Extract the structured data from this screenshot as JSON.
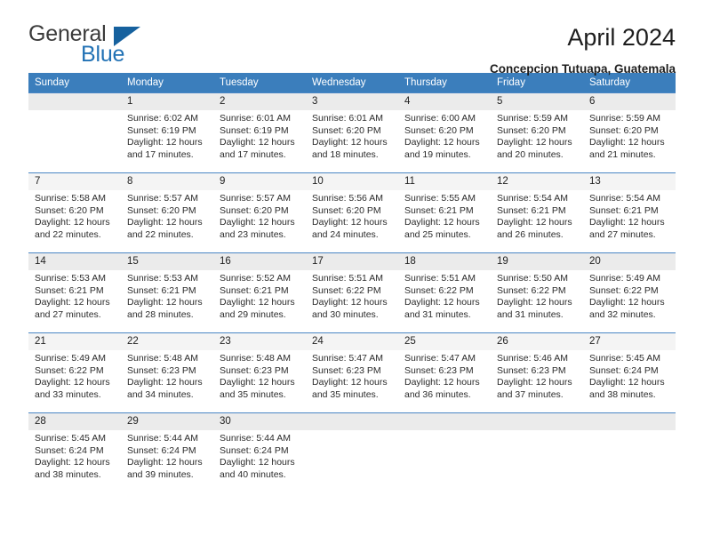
{
  "brand": {
    "name_part1": "General",
    "name_part2": "Blue",
    "triangle_color": "#16619e",
    "blue_color": "#2272b5"
  },
  "header": {
    "title": "April 2024",
    "subtitle": "Concepcion Tutuapa, Guatemala",
    "header_bg": "#3b7ebc"
  },
  "weekdays": [
    "Sunday",
    "Monday",
    "Tuesday",
    "Wednesday",
    "Thursday",
    "Friday",
    "Saturday"
  ],
  "weeks": [
    {
      "days": [
        {
          "num": "",
          "sunrise": "",
          "sunset": "",
          "daylight1": "",
          "daylight2": "",
          "empty": true
        },
        {
          "num": "1",
          "sunrise": "Sunrise: 6:02 AM",
          "sunset": "Sunset: 6:19 PM",
          "daylight1": "Daylight: 12 hours",
          "daylight2": "and 17 minutes."
        },
        {
          "num": "2",
          "sunrise": "Sunrise: 6:01 AM",
          "sunset": "Sunset: 6:19 PM",
          "daylight1": "Daylight: 12 hours",
          "daylight2": "and 17 minutes."
        },
        {
          "num": "3",
          "sunrise": "Sunrise: 6:01 AM",
          "sunset": "Sunset: 6:20 PM",
          "daylight1": "Daylight: 12 hours",
          "daylight2": "and 18 minutes."
        },
        {
          "num": "4",
          "sunrise": "Sunrise: 6:00 AM",
          "sunset": "Sunset: 6:20 PM",
          "daylight1": "Daylight: 12 hours",
          "daylight2": "and 19 minutes."
        },
        {
          "num": "5",
          "sunrise": "Sunrise: 5:59 AM",
          "sunset": "Sunset: 6:20 PM",
          "daylight1": "Daylight: 12 hours",
          "daylight2": "and 20 minutes."
        },
        {
          "num": "6",
          "sunrise": "Sunrise: 5:59 AM",
          "sunset": "Sunset: 6:20 PM",
          "daylight1": "Daylight: 12 hours",
          "daylight2": "and 21 minutes."
        }
      ]
    },
    {
      "days": [
        {
          "num": "7",
          "sunrise": "Sunrise: 5:58 AM",
          "sunset": "Sunset: 6:20 PM",
          "daylight1": "Daylight: 12 hours",
          "daylight2": "and 22 minutes."
        },
        {
          "num": "8",
          "sunrise": "Sunrise: 5:57 AM",
          "sunset": "Sunset: 6:20 PM",
          "daylight1": "Daylight: 12 hours",
          "daylight2": "and 22 minutes."
        },
        {
          "num": "9",
          "sunrise": "Sunrise: 5:57 AM",
          "sunset": "Sunset: 6:20 PM",
          "daylight1": "Daylight: 12 hours",
          "daylight2": "and 23 minutes."
        },
        {
          "num": "10",
          "sunrise": "Sunrise: 5:56 AM",
          "sunset": "Sunset: 6:20 PM",
          "daylight1": "Daylight: 12 hours",
          "daylight2": "and 24 minutes."
        },
        {
          "num": "11",
          "sunrise": "Sunrise: 5:55 AM",
          "sunset": "Sunset: 6:21 PM",
          "daylight1": "Daylight: 12 hours",
          "daylight2": "and 25 minutes."
        },
        {
          "num": "12",
          "sunrise": "Sunrise: 5:54 AM",
          "sunset": "Sunset: 6:21 PM",
          "daylight1": "Daylight: 12 hours",
          "daylight2": "and 26 minutes."
        },
        {
          "num": "13",
          "sunrise": "Sunrise: 5:54 AM",
          "sunset": "Sunset: 6:21 PM",
          "daylight1": "Daylight: 12 hours",
          "daylight2": "and 27 minutes."
        }
      ]
    },
    {
      "days": [
        {
          "num": "14",
          "sunrise": "Sunrise: 5:53 AM",
          "sunset": "Sunset: 6:21 PM",
          "daylight1": "Daylight: 12 hours",
          "daylight2": "and 27 minutes."
        },
        {
          "num": "15",
          "sunrise": "Sunrise: 5:53 AM",
          "sunset": "Sunset: 6:21 PM",
          "daylight1": "Daylight: 12 hours",
          "daylight2": "and 28 minutes."
        },
        {
          "num": "16",
          "sunrise": "Sunrise: 5:52 AM",
          "sunset": "Sunset: 6:21 PM",
          "daylight1": "Daylight: 12 hours",
          "daylight2": "and 29 minutes."
        },
        {
          "num": "17",
          "sunrise": "Sunrise: 5:51 AM",
          "sunset": "Sunset: 6:22 PM",
          "daylight1": "Daylight: 12 hours",
          "daylight2": "and 30 minutes."
        },
        {
          "num": "18",
          "sunrise": "Sunrise: 5:51 AM",
          "sunset": "Sunset: 6:22 PM",
          "daylight1": "Daylight: 12 hours",
          "daylight2": "and 31 minutes."
        },
        {
          "num": "19",
          "sunrise": "Sunrise: 5:50 AM",
          "sunset": "Sunset: 6:22 PM",
          "daylight1": "Daylight: 12 hours",
          "daylight2": "and 31 minutes."
        },
        {
          "num": "20",
          "sunrise": "Sunrise: 5:49 AM",
          "sunset": "Sunset: 6:22 PM",
          "daylight1": "Daylight: 12 hours",
          "daylight2": "and 32 minutes."
        }
      ]
    },
    {
      "days": [
        {
          "num": "21",
          "sunrise": "Sunrise: 5:49 AM",
          "sunset": "Sunset: 6:22 PM",
          "daylight1": "Daylight: 12 hours",
          "daylight2": "and 33 minutes."
        },
        {
          "num": "22",
          "sunrise": "Sunrise: 5:48 AM",
          "sunset": "Sunset: 6:23 PM",
          "daylight1": "Daylight: 12 hours",
          "daylight2": "and 34 minutes."
        },
        {
          "num": "23",
          "sunrise": "Sunrise: 5:48 AM",
          "sunset": "Sunset: 6:23 PM",
          "daylight1": "Daylight: 12 hours",
          "daylight2": "and 35 minutes."
        },
        {
          "num": "24",
          "sunrise": "Sunrise: 5:47 AM",
          "sunset": "Sunset: 6:23 PM",
          "daylight1": "Daylight: 12 hours",
          "daylight2": "and 35 minutes."
        },
        {
          "num": "25",
          "sunrise": "Sunrise: 5:47 AM",
          "sunset": "Sunset: 6:23 PM",
          "daylight1": "Daylight: 12 hours",
          "daylight2": "and 36 minutes."
        },
        {
          "num": "26",
          "sunrise": "Sunrise: 5:46 AM",
          "sunset": "Sunset: 6:23 PM",
          "daylight1": "Daylight: 12 hours",
          "daylight2": "and 37 minutes."
        },
        {
          "num": "27",
          "sunrise": "Sunrise: 5:45 AM",
          "sunset": "Sunset: 6:24 PM",
          "daylight1": "Daylight: 12 hours",
          "daylight2": "and 38 minutes."
        }
      ]
    },
    {
      "days": [
        {
          "num": "28",
          "sunrise": "Sunrise: 5:45 AM",
          "sunset": "Sunset: 6:24 PM",
          "daylight1": "Daylight: 12 hours",
          "daylight2": "and 38 minutes."
        },
        {
          "num": "29",
          "sunrise": "Sunrise: 5:44 AM",
          "sunset": "Sunset: 6:24 PM",
          "daylight1": "Daylight: 12 hours",
          "daylight2": "and 39 minutes."
        },
        {
          "num": "30",
          "sunrise": "Sunrise: 5:44 AM",
          "sunset": "Sunset: 6:24 PM",
          "daylight1": "Daylight: 12 hours",
          "daylight2": "and 40 minutes."
        },
        {
          "num": "",
          "sunrise": "",
          "sunset": "",
          "daylight1": "",
          "daylight2": "",
          "empty": true
        },
        {
          "num": "",
          "sunrise": "",
          "sunset": "",
          "daylight1": "",
          "daylight2": "",
          "empty": true
        },
        {
          "num": "",
          "sunrise": "",
          "sunset": "",
          "daylight1": "",
          "daylight2": "",
          "empty": true
        },
        {
          "num": "",
          "sunrise": "",
          "sunset": "",
          "daylight1": "",
          "daylight2": "",
          "empty": true
        }
      ]
    }
  ]
}
